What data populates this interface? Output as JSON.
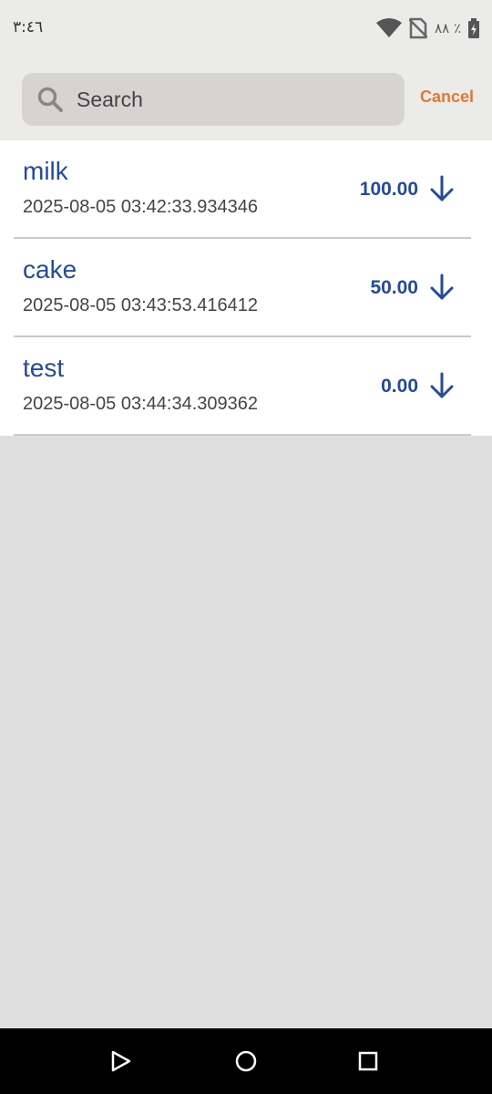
{
  "status_bar": {
    "time": "٣:٤٦",
    "battery_text": "٨٨ ٪",
    "icons": [
      "wifi-icon",
      "no-sim-icon",
      "battery-icon"
    ]
  },
  "search": {
    "placeholder": "Search",
    "cancel_label": "Cancel"
  },
  "colors": {
    "accent": "#e8772e",
    "item_text": "#254a9a",
    "search_bg": "#d7d3d3"
  },
  "items": [
    {
      "name": "milk",
      "date": "2025-08-05 03:42:33.934346",
      "amount": "100.00",
      "icon": "arrow-down-icon"
    },
    {
      "name": "cake",
      "date": "2025-08-05 03:43:53.416412",
      "amount": "50.00",
      "icon": "arrow-down-icon"
    },
    {
      "name": "test",
      "date": "2025-08-05 03:44:34.309362",
      "amount": "0.00",
      "icon": "arrow-down-icon"
    }
  ],
  "nav": [
    "back-icon",
    "home-icon",
    "recents-icon"
  ]
}
